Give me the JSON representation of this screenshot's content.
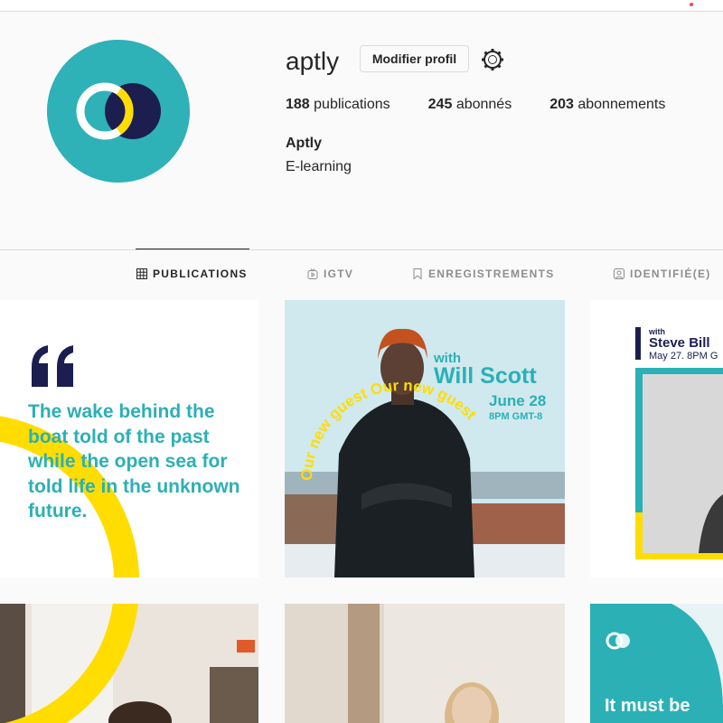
{
  "profile": {
    "username": "aptly",
    "edit_button": "Modifier profil",
    "stats": [
      {
        "value": "188",
        "label": "publications"
      },
      {
        "value": "245",
        "label": "abonnés"
      },
      {
        "value": "203",
        "label": "abonnements"
      }
    ],
    "full_name": "Aptly",
    "bio": "E-learning"
  },
  "tabs": [
    {
      "label": "PUBLICATIONS",
      "icon": "grid-icon",
      "active": true
    },
    {
      "label": "IGTV",
      "icon": "igtv-icon",
      "active": false
    },
    {
      "label": "ENREGISTREMENTS",
      "icon": "bookmark-icon",
      "active": false
    },
    {
      "label": "IDENTIFIÉ(E)",
      "icon": "tagged-icon",
      "active": false
    }
  ],
  "posts": [
    {
      "quote": "The wake behind the boat told of the past while the open sea for told life in the unknown future."
    },
    {
      "with": "with",
      "name": "Will Scott",
      "date": "June 28",
      "time": "8PM GMT-8",
      "curved_text": "Our new guest Our new guest"
    },
    {
      "with": "with",
      "name": "Steve Bill",
      "date": "May 27. 8PM G"
    },
    {},
    {},
    {
      "text": "It must be"
    }
  ],
  "colors": {
    "brand_teal": "#2bb0b5",
    "brand_navy": "#1b1e4f",
    "brand_yellow": "#ffdd00"
  }
}
